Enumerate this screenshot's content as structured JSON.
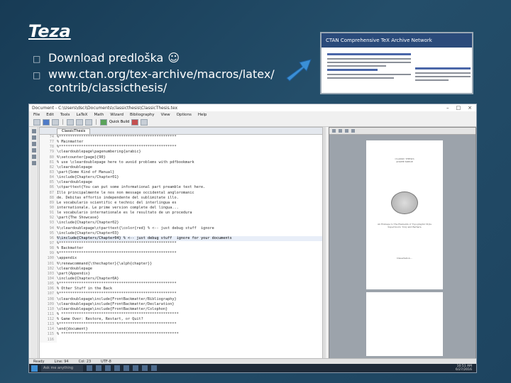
{
  "slide": {
    "title": "Teza",
    "bullets": [
      {
        "text": "Download predloška",
        "emoji": "☺"
      },
      {
        "text": "www.ctan.org/tex-archive/macros/latex/ contrib/classicthesis/"
      }
    ]
  },
  "window": {
    "title": "Document - C:\\Users\\dsci\\Documents\\classicthesis\\ClassicThesis.tex",
    "controls": [
      "–",
      "□",
      "×"
    ],
    "menu": [
      "File",
      "Edit",
      "Tools",
      "LaTeX",
      "Math",
      "Wizard",
      "Bibliography",
      "View",
      "Options",
      "Help"
    ],
    "toolbar_label": "Quick Build",
    "tab": "ClassicThesis",
    "status": [
      "Ready",
      "Line: 94",
      "Col: 23",
      "UTF-8"
    ]
  },
  "editor": {
    "lines": [
      {
        "n": "74",
        "t": "%*****************************************************"
      },
      {
        "n": "77",
        "t": "% Mainmatter"
      },
      {
        "n": "78",
        "t": "%*****************************************************"
      },
      {
        "n": "79",
        "t": "\\cleardoublepage\\pagenumbering{arabic}"
      },
      {
        "n": "80",
        "t": "%\\setcounter{page}{90}"
      },
      {
        "n": "81",
        "t": "% use \\cleardoublepage here to avoid problems with pdfbookmark"
      },
      {
        "n": "82",
        "t": "\\cleardoublepage"
      },
      {
        "n": "83",
        "t": "\\part{Some Kind of Manual}"
      },
      {
        "n": "84",
        "t": "\\include{Chapters/Chapter01}"
      },
      {
        "n": "85",
        "t": "\\cleardoublepage"
      },
      {
        "n": "86",
        "t": "\\ctparttext{You can put some informational part preamble text here."
      },
      {
        "n": "87",
        "t": "Illo principalmente le nos non message occidental angloromanic"
      },
      {
        "n": "88",
        "t": "de. Debitas effortio independente del sublimitate illo."
      },
      {
        "n": "89",
        "t": "Le vocabulario scientific e technic del interlingua es"
      },
      {
        "n": "90",
        "t": "internationale. Le prime version complete del lingua..."
      },
      {
        "n": "91",
        "t": "le vocabulario internationale es le resultato de un procedura"
      },
      {
        "n": "92",
        "t": "\\part{The Showcase}"
      },
      {
        "n": "93",
        "t": "\\include{Chapters/Chapter02}"
      },
      {
        "n": "94",
        "t": "%\\cleardoublepage\\ctparttext{\\color{red} % <-- just debug stuff  ignore"
      },
      {
        "n": "95",
        "t": "\\include{Chapters/Chapter03}"
      },
      {
        "n": "96",
        "t": "%\\include{Chapters/Chapter04} % <-- just debug stuff  ignore for your documents",
        "hl": true
      },
      {
        "n": "97",
        "t": "%*****************************************************"
      },
      {
        "n": "98",
        "t": "% Backmatter"
      },
      {
        "n": "99",
        "t": "%*****************************************************"
      },
      {
        "n": "100",
        "t": "\\appendix"
      },
      {
        "n": "101",
        "t": "%\\renewcommand{\\thechapter}{\\alph{chapter}}"
      },
      {
        "n": "102",
        "t": "\\cleardoublepage"
      },
      {
        "n": "103",
        "t": "\\part{Appendix}"
      },
      {
        "n": "104",
        "t": "\\include{Chapters/Chapter0A}"
      },
      {
        "n": "105",
        "t": "%*****************************************************"
      },
      {
        "n": "106",
        "t": "% Other Stuff in the Back"
      },
      {
        "n": "107",
        "t": "%*****************************************************"
      },
      {
        "n": "108",
        "t": "\\cleardoublepage\\include{FrontBackmatter/Bibliography}"
      },
      {
        "n": "109",
        "t": "\\cleardoublepage\\include{FrontBackmatter/Declaration}"
      },
      {
        "n": "110",
        "t": "\\cleardoublepage\\include{FrontBackmatter/Colophon}"
      },
      {
        "n": "111",
        "t": "% *****************************************************"
      },
      {
        "n": "112",
        "t": "% Game Over: Restore, Restart, or Quit?"
      },
      {
        "n": "113",
        "t": "%*****************************************************"
      },
      {
        "n": "114",
        "t": "\\end{document}"
      },
      {
        "n": "115",
        "t": "% *****************************************************"
      },
      {
        "n": "116",
        "t": ""
      }
    ]
  },
  "preview": {
    "page1_lines": [
      "CLASSIC THESIS",
      "ANDRÉ MIEDE",
      "",
      "An Homage to The Elements of Typographic Style",
      "Supervisors: Tony and Barbara",
      "Dissertation..."
    ]
  },
  "taskbar": {
    "search": "Ask me anything",
    "time": "10:51 AM",
    "date": "6/27/2016"
  },
  "thumbnail": {
    "logo": "CTAN Comprehensive TeX Archive Network"
  }
}
